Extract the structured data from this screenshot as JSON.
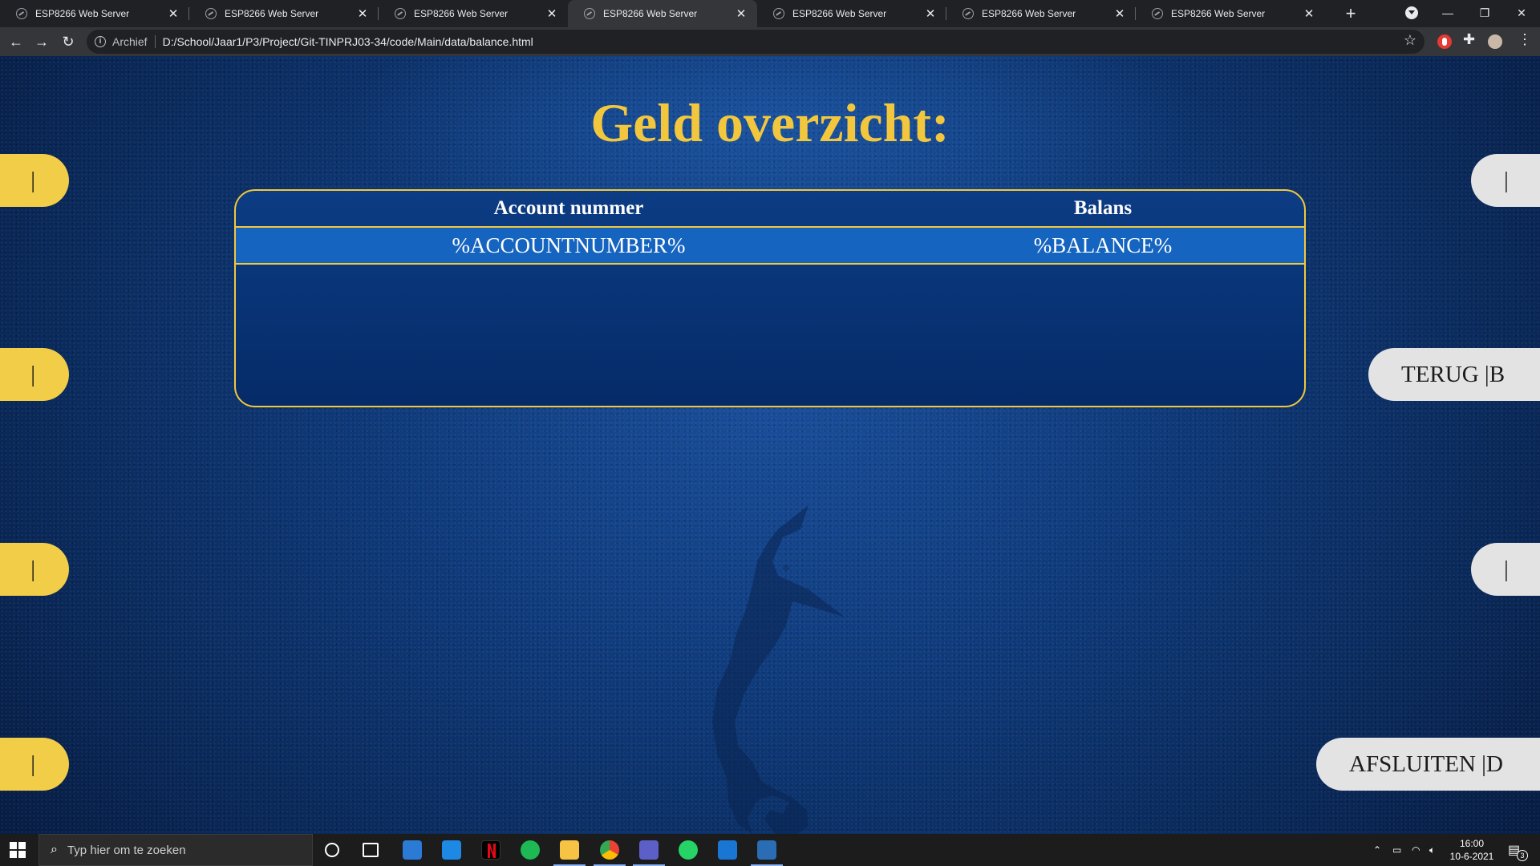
{
  "browser": {
    "tabs": [
      {
        "title": "ESP8266 Web Server",
        "active": false
      },
      {
        "title": "ESP8266 Web Server",
        "active": false
      },
      {
        "title": "ESP8266 Web Server",
        "active": false
      },
      {
        "title": "ESP8266 Web Server",
        "active": true
      },
      {
        "title": "ESP8266 Web Server",
        "active": false
      },
      {
        "title": "ESP8266 Web Server",
        "active": false
      },
      {
        "title": "ESP8266 Web Server",
        "active": false
      }
    ],
    "origin_chip": "Archief",
    "url": "D:/School/Jaar1/P3/Project/Git-TINPRJ03-34/code/Main/data/balance.html"
  },
  "page": {
    "title": "Geld overzicht:",
    "table": {
      "headers": [
        "Account nummer",
        "Balans"
      ],
      "rows": [
        [
          "%ACCOUNTNUMBER%",
          "%BALANCE%"
        ]
      ]
    },
    "left_keys": [
      "|",
      "|",
      "|",
      "|"
    ],
    "right_keys": [
      "|",
      "TERUG |B",
      "|",
      "AFSLUITEN |D"
    ],
    "colors": {
      "accent": "#f2c73d",
      "row": "#1565c0",
      "background": "#0f3b7c"
    }
  },
  "taskbar": {
    "search_placeholder": "Typ hier om te zoeken",
    "time": "16:00",
    "date": "10-6-2021",
    "notification_count": "3",
    "apps": [
      "cortana-icon",
      "task-view-icon",
      "store-icon",
      "mail-icon",
      "netflix-icon",
      "spotify-icon",
      "file-explorer-icon",
      "chrome-icon",
      "teams-icon",
      "whatsapp-icon",
      "vscode-icon",
      "powershell-icon"
    ]
  }
}
